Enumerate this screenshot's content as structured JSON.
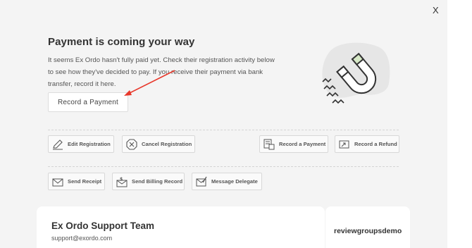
{
  "close_label": "X",
  "payment": {
    "title": "Payment is coming your way",
    "description": "It seems Ex Ordo hasn't fully paid yet. Check their registration activity below to see how they've decided to pay. If you receive their payment via bank transfer, record it here.",
    "record_button": "Record a Payment"
  },
  "actions_row1": [
    {
      "label": "Edit Registration",
      "icon": "edit-icon"
    },
    {
      "label": "Cancel Registration",
      "icon": "cancel-icon"
    },
    {
      "label": "Record a Payment",
      "icon": "payment-icon"
    },
    {
      "label": "Record a Refund",
      "icon": "refund-icon"
    }
  ],
  "actions_row2": [
    {
      "label": "Send Receipt",
      "icon": "receipt-icon"
    },
    {
      "label": "Send Billing Record",
      "icon": "billing-record-icon"
    },
    {
      "label": "Message Delegate",
      "icon": "message-icon"
    }
  ],
  "contact_card": {
    "name": "Ex Ordo Support Team",
    "email": "support@exordo.com"
  },
  "group_card": {
    "title": "reviewgroupsdemo"
  },
  "colors": {
    "accent_arrow": "#e8382b",
    "magnet_green": "#d6e8c6",
    "panel_bg": "#f4f4f4"
  }
}
